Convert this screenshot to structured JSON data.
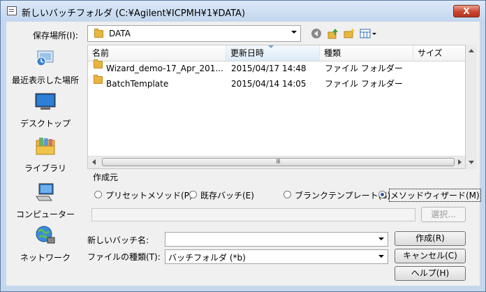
{
  "window": {
    "title": "新しいバッチフォルダ (C:¥Agilent¥ICPMH¥1¥DATA)",
    "close_label": "X"
  },
  "location": {
    "label": "保存場所(I):",
    "value": "DATA"
  },
  "places": [
    {
      "label": "最近表示した場所",
      "icon": "recent-places-icon"
    },
    {
      "label": "デスクトップ",
      "icon": "desktop-icon"
    },
    {
      "label": "ライブラリ",
      "icon": "libraries-icon"
    },
    {
      "label": "コンピューター",
      "icon": "computer-icon"
    },
    {
      "label": "ネットワーク",
      "icon": "network-icon"
    }
  ],
  "columns": [
    "名前",
    "更新日時",
    "種類",
    "サイズ"
  ],
  "files": [
    {
      "name": "Wizard_demo-17_Apr_201...",
      "date": "2015/04/17 14:48",
      "type": "ファイル フォルダー",
      "size": ""
    },
    {
      "name": "BatchTemplate",
      "date": "2015/04/14 14:05",
      "type": "ファイル フォルダー",
      "size": ""
    }
  ],
  "scroll_thumb_glyph": "Ⅲ",
  "create_from": {
    "label": "作成元",
    "options": [
      {
        "label": "プリセットメソッド(P)",
        "selected": false
      },
      {
        "label": "既存バッチ(E)",
        "selected": false
      },
      {
        "label": "ブランクテンプレート(B)",
        "selected": false
      },
      {
        "label": "メソッドウィザード(M)",
        "selected": true
      }
    ],
    "select_button": "選択..."
  },
  "batch_name": {
    "label": "新しいバッチ名:",
    "value": ""
  },
  "file_type": {
    "label": "ファイルの種類(T):",
    "value": "バッチフォルダ (*b)"
  },
  "buttons": {
    "create": "作成(R)",
    "cancel": "キャンセル(C)",
    "help": "ヘルプ(H)"
  },
  "colors": {
    "titlebar": "#c5d7ec",
    "close": "#c9452e",
    "selected_radio": "#2b5a9c"
  }
}
